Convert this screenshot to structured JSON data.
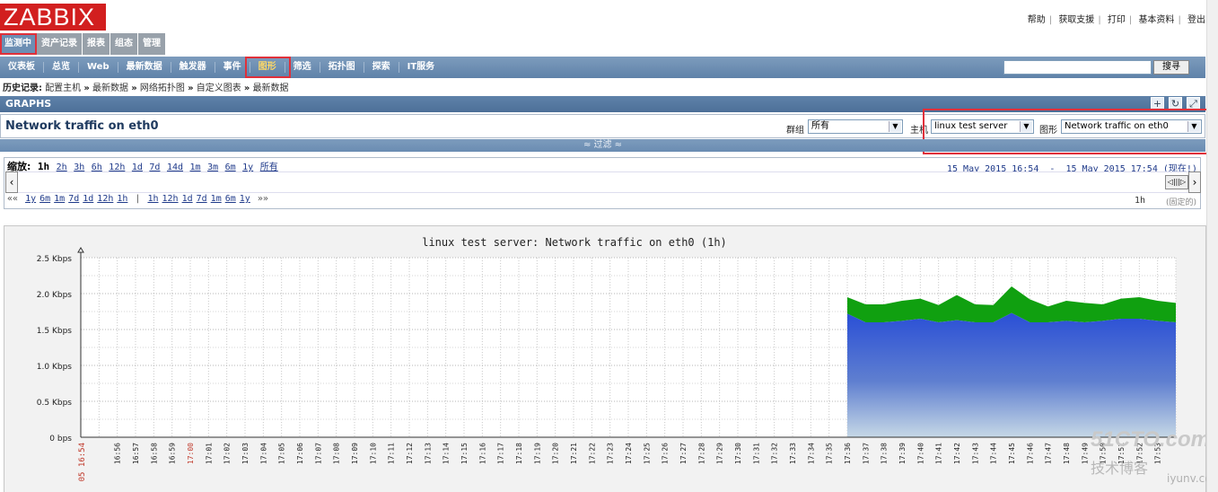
{
  "logo": {
    "text": "ZABBIX"
  },
  "toplinks": [
    "帮助",
    "获取支援",
    "打印",
    "基本资料",
    "登出"
  ],
  "main_menu": [
    {
      "label": "监测中",
      "active": true
    },
    {
      "label": "资产记录"
    },
    {
      "label": "报表"
    },
    {
      "label": "组态"
    },
    {
      "label": "管理"
    }
  ],
  "sub_menu": [
    {
      "label": "仪表板"
    },
    {
      "label": "总览"
    },
    {
      "label": "Web"
    },
    {
      "label": "最新数据"
    },
    {
      "label": "触发器"
    },
    {
      "label": "事件"
    },
    {
      "label": "图形",
      "active": true
    },
    {
      "label": "筛选"
    },
    {
      "label": "拓扑图"
    },
    {
      "label": "探索"
    },
    {
      "label": "IT服务"
    }
  ],
  "search": {
    "value": "",
    "button": "搜寻"
  },
  "breadcrumb": {
    "label": "历史记录:",
    "items": [
      "配置主机",
      "最新数据",
      "网络拓扑图",
      "自定义图表",
      "最新数据"
    ]
  },
  "section": {
    "title": "GRAPHS"
  },
  "graph_header": {
    "title": "Network traffic on eth0",
    "group_label": "群组",
    "group_value": "所有",
    "host_label": "主机",
    "host_value": "linux test server",
    "graph_label": "图形",
    "graph_value": "Network traffic on eth0"
  },
  "filter": {
    "label": "≈ 过滤 ≈"
  },
  "timeline": {
    "zoom_label": "缩放:",
    "zoom_options": [
      "1h",
      "2h",
      "3h",
      "6h",
      "12h",
      "1d",
      "7d",
      "14d",
      "1m",
      "3m",
      "6m",
      "1y",
      "所有"
    ],
    "period_from": "15 May 2015 16:54",
    "period_sep": "-",
    "period_to": "15 May 2015 17:54",
    "now_label": "(现在!)",
    "nav_back": [
      "1y",
      "6m",
      "1m",
      "7d",
      "1d",
      "12h",
      "1h"
    ],
    "nav_fwd": [
      "1h",
      "12h",
      "1d",
      "7d",
      "1m",
      "6m",
      "1y"
    ],
    "period_length": "1h",
    "fixed_label": "(固定的)"
  },
  "watermark": {
    "line1": "51CTO.com",
    "line2": "技术博客",
    "line3": "iyunv.com"
  },
  "colors": {
    "incoming": "#2a4fd6",
    "outgoing": "#10a010",
    "accent": "#5f82a9",
    "highlight": "#e0303a"
  },
  "chart_data": {
    "type": "area",
    "title": "linux test server: Network traffic on eth0 (1h)",
    "ylabel": "",
    "y_ticks": [
      "0 bps",
      "0.5 Kbps",
      "1.0 Kbps",
      "1.5 Kbps",
      "2.0 Kbps",
      "2.5 Kbps"
    ],
    "ylim": [
      0,
      2.5
    ],
    "y_unit": "Kbps",
    "x_start_label": "05 16:54",
    "x_labels": [
      "16:56",
      "16:57",
      "16:58",
      "16:59",
      "17:00",
      "17:01",
      "17:02",
      "17:03",
      "17:04",
      "17:05",
      "17:06",
      "17:07",
      "17:08",
      "17:09",
      "17:10",
      "17:11",
      "17:12",
      "17:13",
      "17:14",
      "17:15",
      "17:16",
      "17:17",
      "17:18",
      "17:19",
      "17:20",
      "17:21",
      "17:22",
      "17:23",
      "17:24",
      "17:25",
      "17:26",
      "17:27",
      "17:28",
      "17:29",
      "17:30",
      "17:31",
      "17:32",
      "17:33",
      "17:34",
      "17:35",
      "17:36",
      "17:37",
      "17:38",
      "17:39",
      "17:40",
      "17:41",
      "17:42",
      "17:43",
      "17:44",
      "17:45",
      "17:46",
      "17:47",
      "17:48",
      "17:49",
      "17:50",
      "17:51",
      "17:52",
      "17:53"
    ],
    "x": [
      "17:36",
      "17:37",
      "17:38",
      "17:39",
      "17:40",
      "17:41",
      "17:42",
      "17:43",
      "17:44",
      "17:45",
      "17:46",
      "17:47",
      "17:48",
      "17:49",
      "17:50",
      "17:51",
      "17:52",
      "17:53",
      "17:54"
    ],
    "series": [
      {
        "values": [
          1.72,
          1.6,
          1.6,
          1.62,
          1.65,
          1.6,
          1.63,
          1.6,
          1.6,
          1.73,
          1.6,
          1.6,
          1.62,
          1.6,
          1.62,
          1.65,
          1.65,
          1.62,
          1.6
        ]
      },
      {
        "values": [
          1.95,
          1.85,
          1.85,
          1.9,
          1.93,
          1.84,
          1.98,
          1.85,
          1.84,
          2.1,
          1.92,
          1.82,
          1.9,
          1.87,
          1.85,
          1.93,
          1.95,
          1.9,
          1.87
        ]
      }
    ],
    "grid": true
  }
}
